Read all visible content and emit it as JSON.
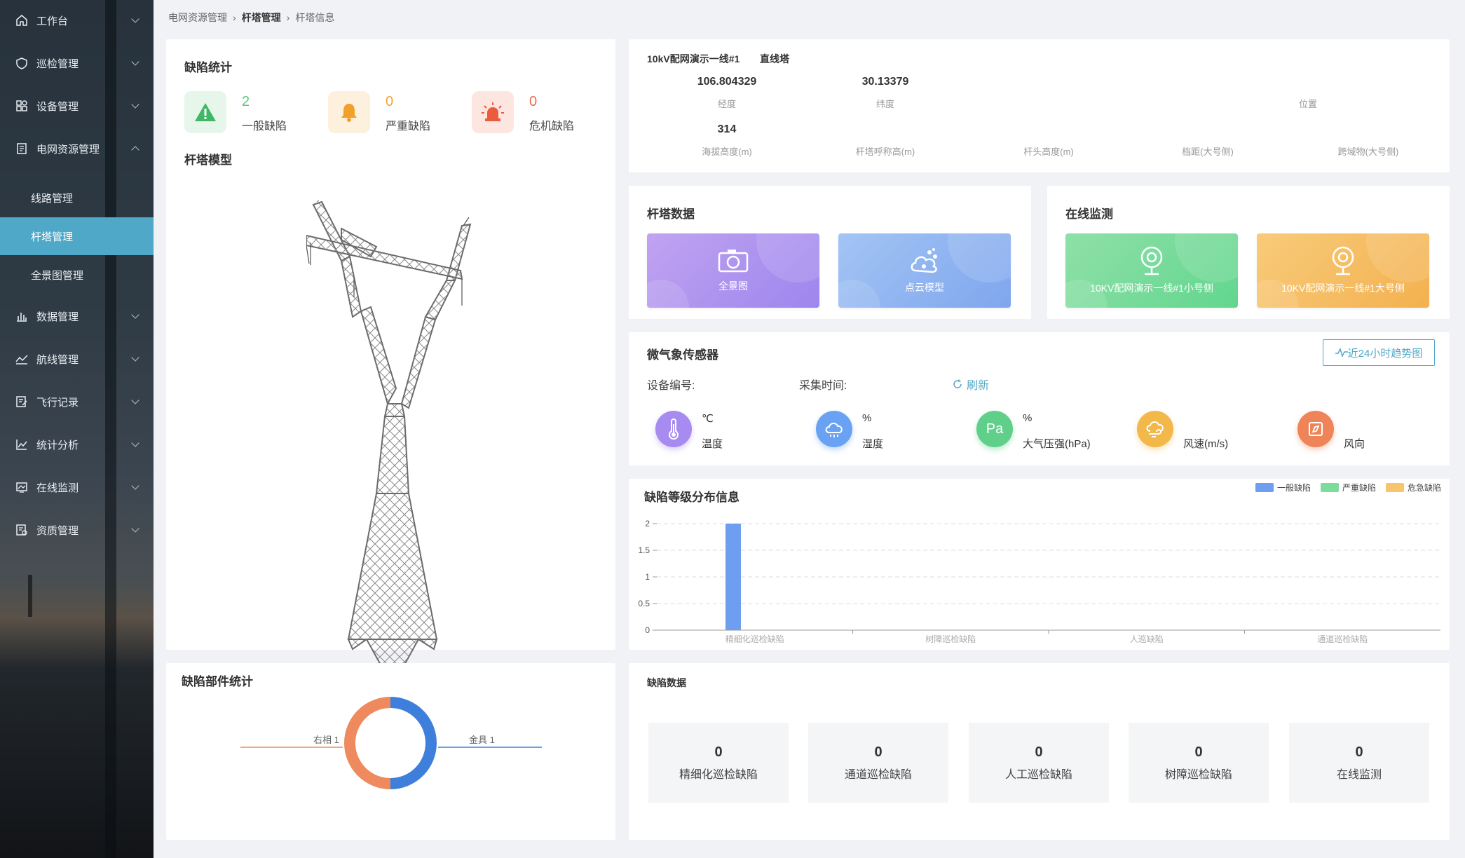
{
  "sidebar": {
    "items": [
      {
        "label": "工作台",
        "icon": "home-icon"
      },
      {
        "label": "巡检管理",
        "icon": "shield-icon"
      },
      {
        "label": "设备管理",
        "icon": "grid-icon"
      },
      {
        "label": "电网资源管理",
        "icon": "document-icon"
      },
      {
        "label": "数据管理",
        "icon": "bar-chart-icon"
      },
      {
        "label": "航线管理",
        "icon": "route-icon"
      },
      {
        "label": "飞行记录",
        "icon": "edit-note-icon"
      },
      {
        "label": "统计分析",
        "icon": "line-chart-icon"
      },
      {
        "label": "在线监测",
        "icon": "monitor-icon"
      },
      {
        "label": "资质管理",
        "icon": "certificate-icon"
      }
    ],
    "sub_items": [
      {
        "label": "线路管理"
      },
      {
        "label": "杆塔管理"
      },
      {
        "label": "全景图管理"
      }
    ]
  },
  "breadcrumb": {
    "items": [
      "电网资源管理",
      "杆塔管理",
      "杆塔信息"
    ]
  },
  "defect_stats": {
    "title": "缺陷统计",
    "items": [
      {
        "count": "2",
        "label": "一般缺陷",
        "color": "#5cc97a"
      },
      {
        "count": "0",
        "label": "严重缺陷",
        "color": "#f2a33a"
      },
      {
        "count": "0",
        "label": "危机缺陷",
        "color": "#ee6b4d"
      }
    ],
    "model_title": "杆塔模型"
  },
  "tower_info": {
    "title": "10kV配网演示一线#1",
    "type": "直线塔",
    "fields": [
      {
        "value": "106.804329",
        "label": "经度"
      },
      {
        "value": "30.13379",
        "label": "纬度"
      },
      {
        "value": "",
        "label": "位置"
      },
      {
        "value": "314",
        "label": "海拔高度(m)"
      },
      {
        "value": "",
        "label": "杆塔呼称高(m)"
      },
      {
        "value": "",
        "label": "杆头高度(m)"
      },
      {
        "value": "",
        "label": "档距(大号侧)"
      },
      {
        "value": "",
        "label": "跨域物(大号侧)"
      }
    ]
  },
  "tower_data": {
    "title": "杆塔数据",
    "tiles": [
      {
        "label": "全景图",
        "icon": "camera-icon"
      },
      {
        "label": "点云模型",
        "icon": "point-cloud-icon"
      }
    ]
  },
  "online_monitor": {
    "title": "在线监测",
    "tiles": [
      {
        "label": "10KV配网演示一线#1小号侧",
        "icon": "webcam-icon"
      },
      {
        "label": "10KV配网演示一线#1大号侧",
        "icon": "webcam-icon"
      }
    ]
  },
  "weather": {
    "title": "微气象传感器",
    "device_label": "设备编号:",
    "time_label": "采集时间:",
    "refresh": "刷新",
    "trend_button": "近24小时趋势图",
    "sensors": [
      {
        "unit": "℃",
        "name": "温度",
        "icon": "thermometer-icon",
        "color": "#a78bf0"
      },
      {
        "unit": "%",
        "name": "湿度",
        "icon": "cloud-icon",
        "color": "#6aa2f3"
      },
      {
        "unit": "%",
        "name": "大气压强(hPa)",
        "icon": "pa-icon",
        "symbol": "Pa",
        "color": "#5fcf8a"
      },
      {
        "unit": "",
        "name": "风速(m/s)",
        "icon": "wind-icon",
        "color": "#f3b84a"
      },
      {
        "unit": "",
        "name": "风向",
        "icon": "compass-icon",
        "color": "#ef8459"
      }
    ]
  },
  "defect_chart": {
    "title": "缺陷等级分布信息"
  },
  "chart_data": {
    "type": "bar",
    "categories": [
      "精细化巡检缺陷",
      "树障巡检缺陷",
      "人巡缺陷",
      "通道巡检缺陷"
    ],
    "series": [
      {
        "name": "一般缺陷",
        "values": [
          2,
          0,
          0,
          0
        ],
        "color": "#6d9ef0"
      },
      {
        "name": "严重缺陷",
        "values": [
          0,
          0,
          0,
          0
        ],
        "color": "#7ddc9c"
      },
      {
        "name": "危急缺陷",
        "values": [
          0,
          0,
          0,
          0
        ],
        "color": "#f7c56c"
      }
    ],
    "ylim": [
      0,
      2
    ],
    "yticks": [
      "0",
      "0.5",
      "1",
      "1.5",
      "2"
    ],
    "grid": true,
    "legend": "top-right"
  },
  "parts_stats": {
    "title": "缺陷部件统计",
    "slices": [
      {
        "name": "右相",
        "value": 1,
        "label": "右相  1",
        "color": "#ee8a5d"
      },
      {
        "name": "金具",
        "value": 1,
        "label": "金具  1",
        "color": "#3f7fdc"
      }
    ]
  },
  "defect_data": {
    "title": "缺陷数据",
    "items": [
      {
        "count": "0",
        "label": "精细化巡检缺陷"
      },
      {
        "count": "0",
        "label": "通道巡检缺陷"
      },
      {
        "count": "0",
        "label": "人工巡检缺陷"
      },
      {
        "count": "0",
        "label": "树障巡检缺陷"
      },
      {
        "count": "0",
        "label": "在线监测"
      }
    ]
  }
}
